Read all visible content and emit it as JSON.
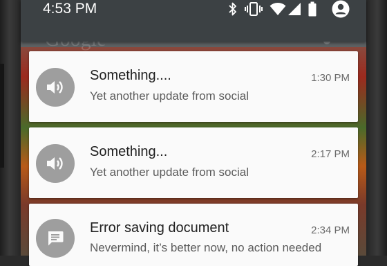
{
  "status_bar": {
    "time": "4:53 PM",
    "icons": [
      "bluetooth-icon",
      "vibrate-icon",
      "wifi-icon",
      "signal-icon",
      "battery-icon",
      "account-icon"
    ]
  },
  "background_search": {
    "logo_text": "Google"
  },
  "notifications": [
    {
      "icon": "volume-icon",
      "title": "Something....",
      "text": "Yet another update from social",
      "time": "1:30 PM"
    },
    {
      "icon": "volume-icon",
      "title": "Something...",
      "text": "Yet another update from social",
      "time": "2:17 PM"
    },
    {
      "icon": "message-icon",
      "title": "Error saving document",
      "text": "Nevermind, it’s better now, no action needed",
      "time": "2:34 PM"
    }
  ],
  "colors": {
    "status_bar": "#3c4144",
    "card_background": "#fafafa",
    "avatar_gray": "#9e9e9e"
  }
}
